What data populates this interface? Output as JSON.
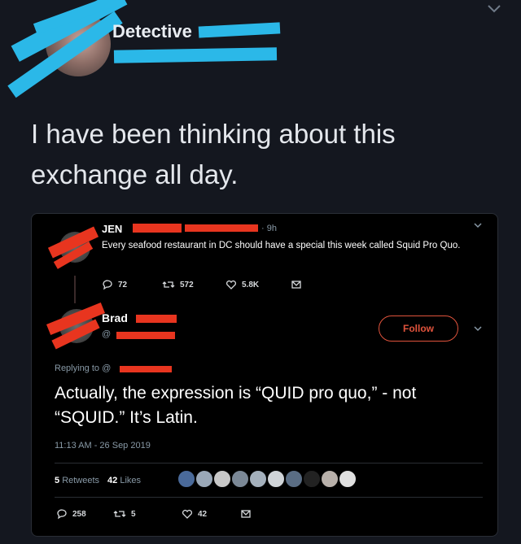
{
  "outer": {
    "author_name": "Detective",
    "post_text": "I have been thinking about this exchange all day."
  },
  "tweet1": {
    "name": "JEN",
    "time": "9h",
    "text": "Every seafood restaurant in DC should have a special this week called Squid Pro Quo.",
    "replies": "72",
    "retweets": "572",
    "likes": "5.8K"
  },
  "tweet2": {
    "name": "Brad",
    "handle": "@",
    "follow_label": "Follow",
    "replying_to": "Replying to @",
    "text": "Actually, the expression is “QUID pro quo,” - not “SQUID.” It’s Latin.",
    "timestamp": "11:13 AM - 26 Sep 2019",
    "retweets_count": "5",
    "retweets_label": "Retweets",
    "likes_count": "42",
    "likes_label": "Likes",
    "replies": "258",
    "retweets": "5",
    "likes": "42"
  },
  "colors": {
    "background": "#14171f",
    "redaction_cyan": "#2bb8e8",
    "redaction_red": "#e8351f",
    "follow_accent": "#e0533c"
  }
}
